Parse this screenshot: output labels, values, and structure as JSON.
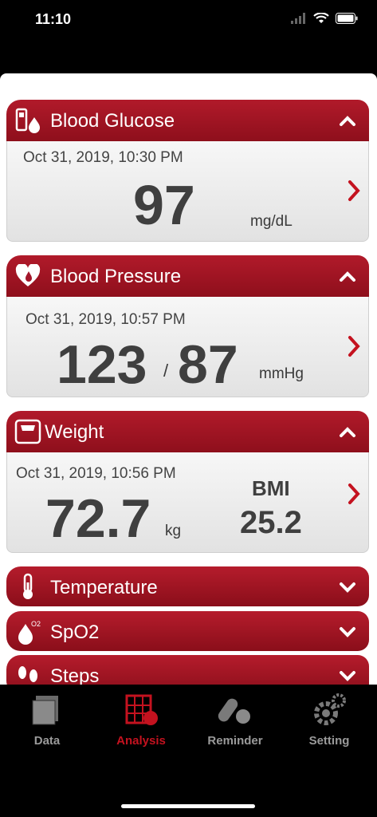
{
  "status": {
    "time": "11:10"
  },
  "glucose": {
    "title": "Blood Glucose",
    "date": "Oct 31, 2019, 10:30 PM",
    "value": "97",
    "unit": "mg/dL"
  },
  "pressure": {
    "title": "Blood Pressure",
    "date": "Oct 31, 2019, 10:57 PM",
    "systolic": "123",
    "separator": "/",
    "diastolic": "87",
    "unit": "mmHg"
  },
  "weight": {
    "title": "Weight",
    "date": "Oct 31, 2019, 10:56 PM",
    "value": "72.7",
    "unit": "kg",
    "bmi_label": "BMI",
    "bmi_value": "25.2"
  },
  "temperature": {
    "title": "Temperature"
  },
  "spo2": {
    "title": "SpO2",
    "icon_sup": "O2"
  },
  "steps": {
    "title": "Steps"
  },
  "tabs": [
    {
      "label": "Data"
    },
    {
      "label": "Analysis"
    },
    {
      "label": "Reminder"
    },
    {
      "label": "Setting"
    }
  ],
  "colors": {
    "accent": "#c4121f",
    "header": "#a3162a",
    "inactive": "#9a9a9a"
  }
}
